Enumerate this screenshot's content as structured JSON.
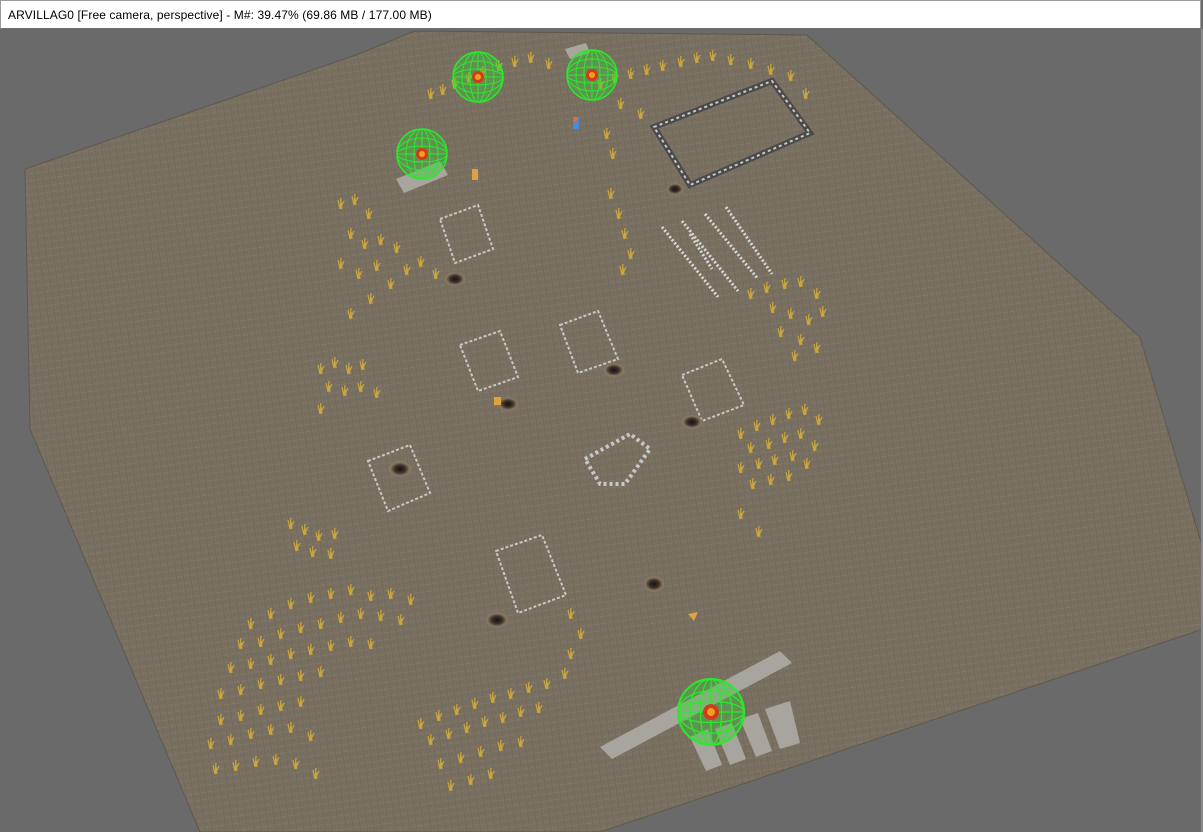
{
  "window": {
    "title": "ARVILLAG0 [Free camera, perspective] - M#: 39.47% (69.86 MB / 177.00 MB)"
  },
  "viewport": {
    "background_color": "#6a6a6a",
    "terrain_color": "#7a7163",
    "grass_color": "#c9a640",
    "trigger_sphere_color": "#2be82b",
    "trigger_core_color": "#d23a1a",
    "outline_color": "#cfcfcf",
    "icons": [
      "wireframe-sphere-icon",
      "crater-icon",
      "item-pickup-icon"
    ]
  }
}
